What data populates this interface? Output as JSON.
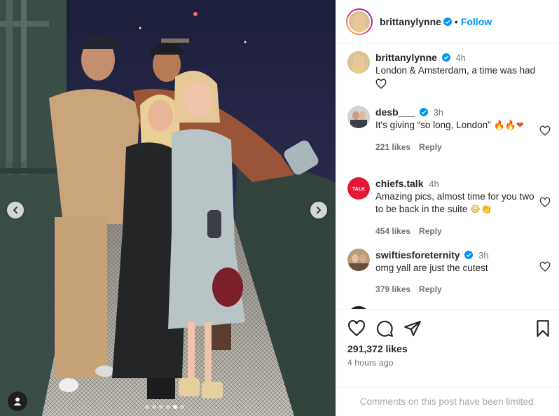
{
  "post": {
    "username": "brittanylynne",
    "follow_label": "Follow",
    "dot": "•",
    "carousel_total": 6,
    "carousel_active": 5
  },
  "caption": {
    "username": "brittanylynne",
    "time": "4h",
    "text": "London & Amsterdam, a time was had"
  },
  "comments": [
    {
      "username": "desb___",
      "verified": true,
      "time": "3h",
      "text": "It's giving “so long, London” ",
      "emoji": "🔥🔥❤",
      "likes": "221 likes",
      "reply": "Reply"
    },
    {
      "username": "chiefs.talk",
      "verified": false,
      "time": "4h",
      "text": "Amazing pics, almost time for you two to be back in the suite ",
      "emoji": "😂👏",
      "likes": "454 likes",
      "reply": "Reply"
    },
    {
      "username": "swiftiesforeternity",
      "verified": true,
      "time": "3h",
      "text": "omg yall are just the cutest",
      "emoji": "",
      "likes": "379 likes",
      "reply": "Reply"
    }
  ],
  "engagement": {
    "likes": "291,372 likes",
    "posted": "4 hours ago"
  },
  "footer": {
    "limited": "Comments on this post have been limited."
  },
  "colors": {
    "accent": "#0095f6",
    "verified": "#0095f6",
    "muted": "#737373",
    "chiefs_red": "#e31837"
  },
  "icons": [
    "verified-badge-icon",
    "heart-icon",
    "comment-icon",
    "share-icon",
    "save-icon",
    "chevron-left-icon",
    "chevron-right-icon",
    "user-tag-icon"
  ]
}
